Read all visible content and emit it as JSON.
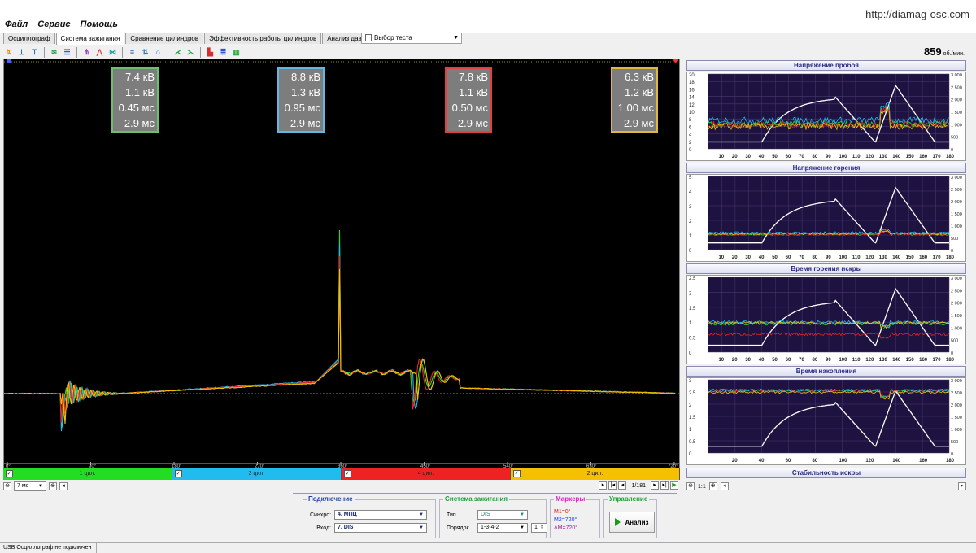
{
  "url": "http://diamag-osc.com",
  "menu": [
    "Файл",
    "Сервис",
    "Помощь"
  ],
  "tabs": [
    {
      "label": "Осциллограф",
      "active": false
    },
    {
      "label": "Система зажигания",
      "active": true
    },
    {
      "label": "Сравнение цилиндров",
      "active": false
    },
    {
      "label": "Эффективность работы цилиндров",
      "active": false
    },
    {
      "label": "Анализ давления в цилиндре",
      "active": false
    }
  ],
  "test_select": {
    "label": "Выбор теста"
  },
  "rpm": {
    "value": "859",
    "unit": "об./мин."
  },
  "cylinders": [
    {
      "label": "1 цил.",
      "color": "#22dd22",
      "border": "#6cc06c",
      "values": [
        "7.4 кВ",
        "1.1 кВ",
        "0.45 мс",
        "2.9 мс"
      ]
    },
    {
      "label": "3 цил.",
      "color": "#22bbee",
      "border": "#5fb8e0",
      "values": [
        "8.8 кВ",
        "1.3 кВ",
        "0.95 мс",
        "2.9 мс"
      ]
    },
    {
      "label": "4 цил.",
      "color": "#ee2222",
      "border": "#e04040",
      "values": [
        "7.8 кВ",
        "1.1 кВ",
        "0.50 мс",
        "2.9 мс"
      ]
    },
    {
      "label": "2 цил.",
      "color": "#f4c000",
      "border": "#e0b840",
      "values": [
        "6.3 кВ",
        "1.2 кВ",
        "1.00 мс",
        "2.9 мс"
      ]
    }
  ],
  "scope_x_ticks": [
    "0°",
    "90°",
    "180°",
    "270°",
    "360°",
    "450°",
    "540°",
    "630°",
    "720°"
  ],
  "left_zoom": {
    "value": "7 мс"
  },
  "pagination": {
    "text": "1/181"
  },
  "right_zoom": {
    "value": "1:1"
  },
  "panels": [
    {
      "title": "Напряжение пробоя",
      "left_ticks": [
        "20",
        "18",
        "16",
        "14",
        "12",
        "10",
        "8",
        "6",
        "4",
        "2",
        "0"
      ],
      "right_ticks": [
        "3 000",
        "2 500",
        "2 000",
        "1 500",
        "1 000",
        "500",
        "0"
      ],
      "x_ticks": [
        "10",
        "20",
        "30",
        "40",
        "50",
        "60",
        "70",
        "80",
        "90",
        "100",
        "110",
        "120",
        "130",
        "140",
        "150",
        "160",
        "170",
        "180"
      ]
    },
    {
      "title": "Напряжение горения",
      "left_ticks": [
        "5",
        "4",
        "3",
        "2",
        "1",
        "0"
      ],
      "right_ticks": [
        "3 000",
        "2 500",
        "2 000",
        "1 500",
        "1 000",
        "500",
        "0"
      ],
      "x_ticks": [
        "10",
        "20",
        "30",
        "40",
        "50",
        "60",
        "70",
        "80",
        "90",
        "100",
        "110",
        "120",
        "130",
        "140",
        "150",
        "160",
        "170",
        "180"
      ]
    },
    {
      "title": "Время горения искры",
      "left_ticks": [
        "2.5",
        "2",
        "1.5",
        "1",
        "0.5",
        "0"
      ],
      "right_ticks": [
        "3 000",
        "2 500",
        "2 000",
        "1 500",
        "1 000",
        "500",
        "0"
      ],
      "x_ticks": [
        "10",
        "20",
        "30",
        "40",
        "50",
        "60",
        "70",
        "80",
        "90",
        "100",
        "110",
        "120",
        "130",
        "140",
        "150",
        "160",
        "170",
        "180"
      ]
    },
    {
      "title": "Время накопления",
      "left_ticks": [
        "3",
        "2.5",
        "2",
        "1.5",
        "1",
        "0.5",
        "0"
      ],
      "right_ticks": [
        "3 000",
        "2 500",
        "2 000",
        "1 500",
        "1 000",
        "500",
        "0"
      ],
      "x_ticks": [
        "20",
        "40",
        "60",
        "80",
        "100",
        "120",
        "140",
        "160",
        "180"
      ]
    },
    {
      "title": "Стабильность искры"
    }
  ],
  "connection": {
    "title": "Подключение",
    "sync_label": "Синхро:",
    "sync_value": "4.  МПЦ",
    "input_label": "Вход:",
    "input_value": "7.  DIS"
  },
  "ignition": {
    "title": "Система зажигания",
    "type_label": "Тип",
    "type_value": "DIS",
    "order_label": "Порядок",
    "order_value": "1-3-4-2",
    "order_num": "1"
  },
  "markers": {
    "title": "Маркеры",
    "m1": "M1=0°",
    "m2": "M2=720°",
    "dm": "ΔM=720°",
    "title_color": "#e020c0",
    "m1_color": "#e02020",
    "m2_color": "#2040e0",
    "dm_color": "#a020a0"
  },
  "control": {
    "title": "Управление",
    "analyze_label": "Анализ"
  },
  "status": "USB Осциллограф не подключен"
}
